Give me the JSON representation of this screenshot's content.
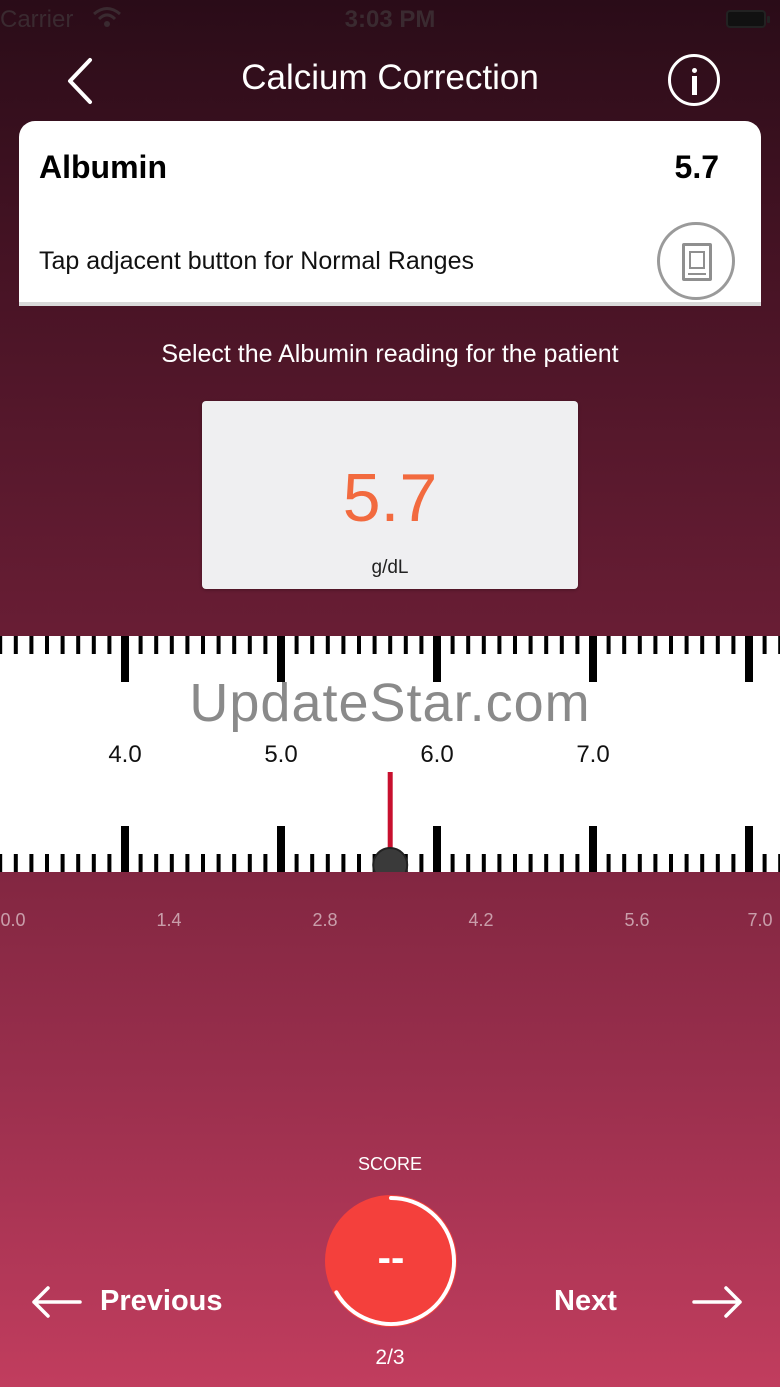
{
  "status_bar": {
    "carrier": "Carrier",
    "time": "3:03 PM"
  },
  "nav": {
    "title": "Calcium Correction",
    "back_icon": "chevron-left-icon",
    "info_icon": "info-icon"
  },
  "card": {
    "label": "Albumin",
    "value": "5.7",
    "hint": "Tap adjacent button for Normal Ranges",
    "ranges_icon": "book-icon"
  },
  "prompt": "Select the Albumin reading for the patient",
  "reading": {
    "value": "5.7",
    "unit": "g/dL",
    "color": "#f26a3f"
  },
  "ruler": {
    "watermark": "UpdateStar.com",
    "labels": [
      "4.0",
      "5.0",
      "6.0",
      "7.0"
    ],
    "selected_value": 5.7,
    "indicator_color": "#c8102e"
  },
  "scale": {
    "labels": [
      "0.0",
      "1.4",
      "2.8",
      "4.2",
      "5.6",
      "7.0"
    ]
  },
  "score": {
    "caption": "SCORE",
    "value": "--",
    "count": "2/3",
    "progress": 0.667,
    "color": "#f4403c"
  },
  "footer": {
    "previous_label": "Previous",
    "next_label": "Next"
  }
}
